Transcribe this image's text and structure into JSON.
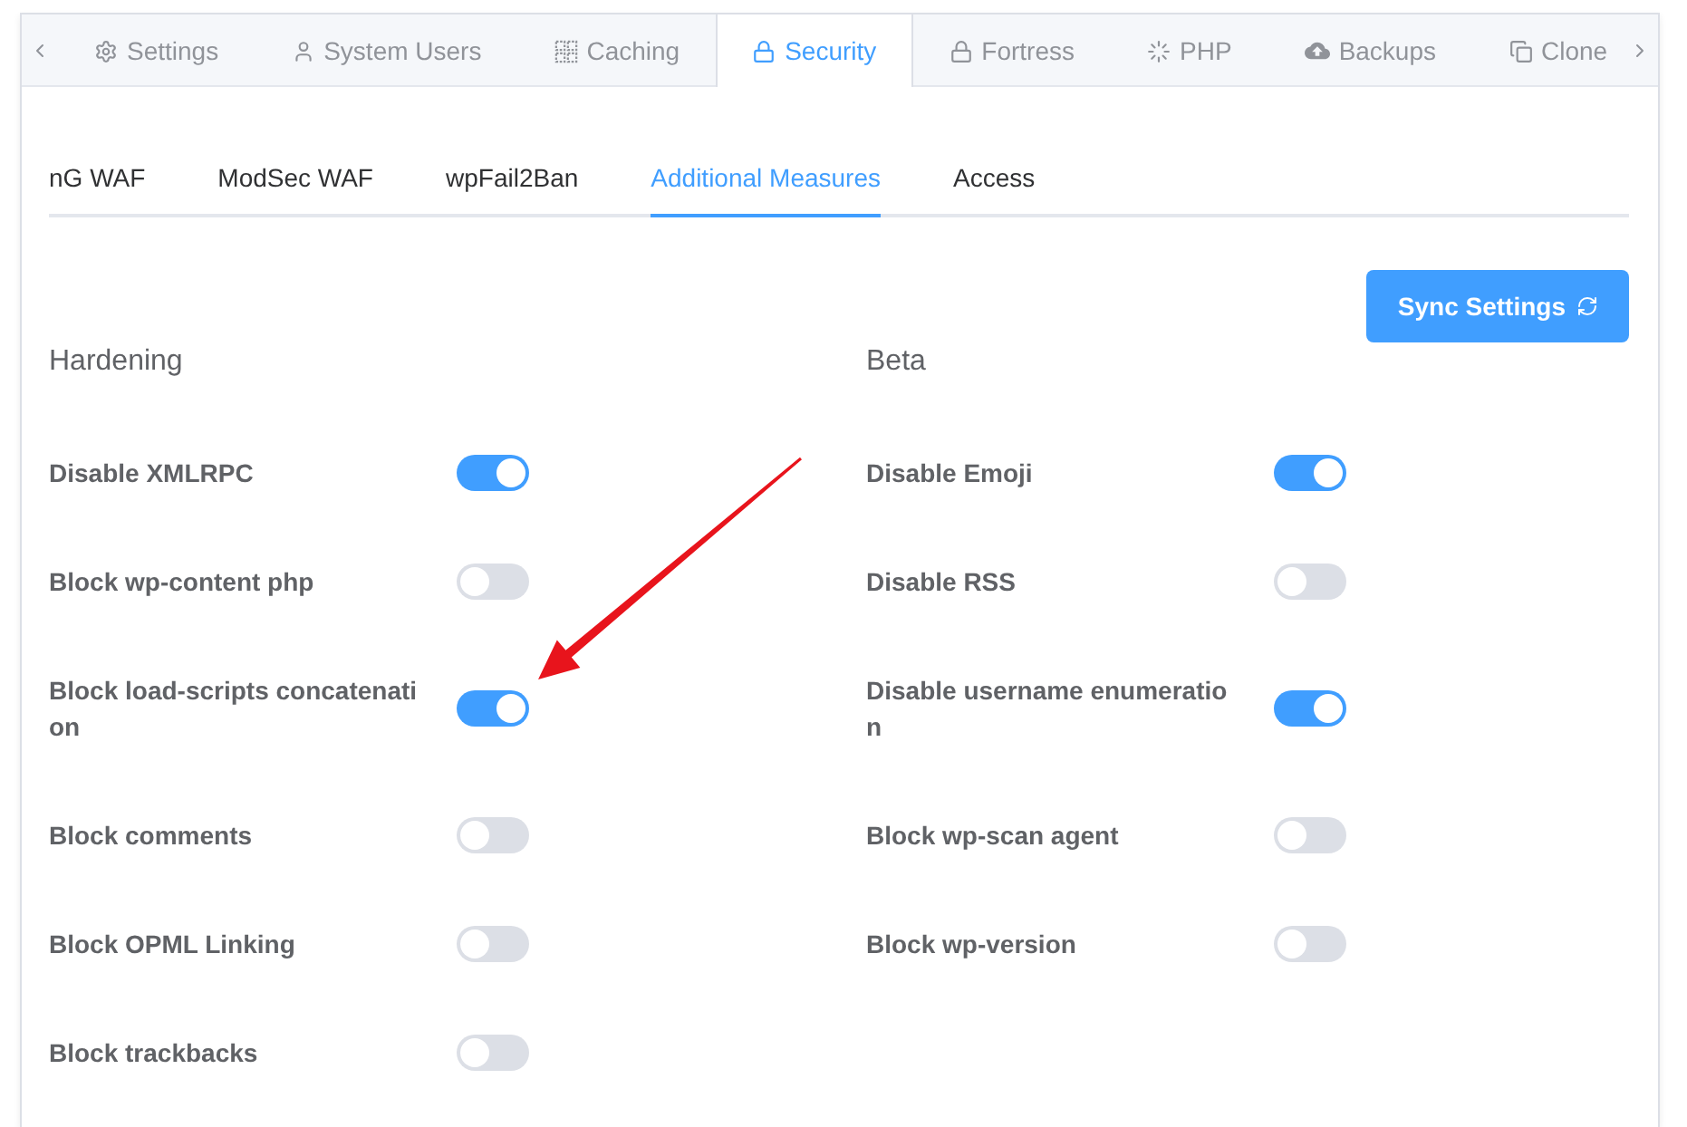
{
  "tabs": [
    {
      "label": "Settings",
      "selected": false
    },
    {
      "label": "System Users",
      "selected": false
    },
    {
      "label": "Caching",
      "selected": false
    },
    {
      "label": "Security",
      "selected": true
    },
    {
      "label": "Fortress",
      "selected": false
    },
    {
      "label": "PHP",
      "selected": false
    },
    {
      "label": "Backups",
      "selected": false
    },
    {
      "label": "Clone",
      "selected": false
    }
  ],
  "subtabs": [
    {
      "label": "nG WAF",
      "selected": false
    },
    {
      "label": "ModSec WAF",
      "selected": false
    },
    {
      "label": "wpFail2Ban",
      "selected": false
    },
    {
      "label": "Additional Measures",
      "selected": true
    },
    {
      "label": "Access",
      "selected": false
    }
  ],
  "sync_button": {
    "label": "Sync Settings"
  },
  "sections": [
    {
      "title": "Hardening",
      "settings": [
        {
          "label": "Disable XMLRPC",
          "on": true
        },
        {
          "label": "Block wp-content php",
          "on": false
        },
        {
          "label": "Block load-scripts concatenation",
          "on": true
        },
        {
          "label": "Block comments",
          "on": false
        },
        {
          "label": "Block OPML Linking",
          "on": false
        },
        {
          "label": "Block trackbacks",
          "on": false
        }
      ]
    },
    {
      "title": "Beta",
      "settings": [
        {
          "label": "Disable Emoji",
          "on": true
        },
        {
          "label": "Disable RSS",
          "on": false
        },
        {
          "label": "Disable username enumeration",
          "on": true
        },
        {
          "label": "Block wp-scan agent",
          "on": false
        },
        {
          "label": "Block wp-version",
          "on": false
        }
      ]
    }
  ]
}
